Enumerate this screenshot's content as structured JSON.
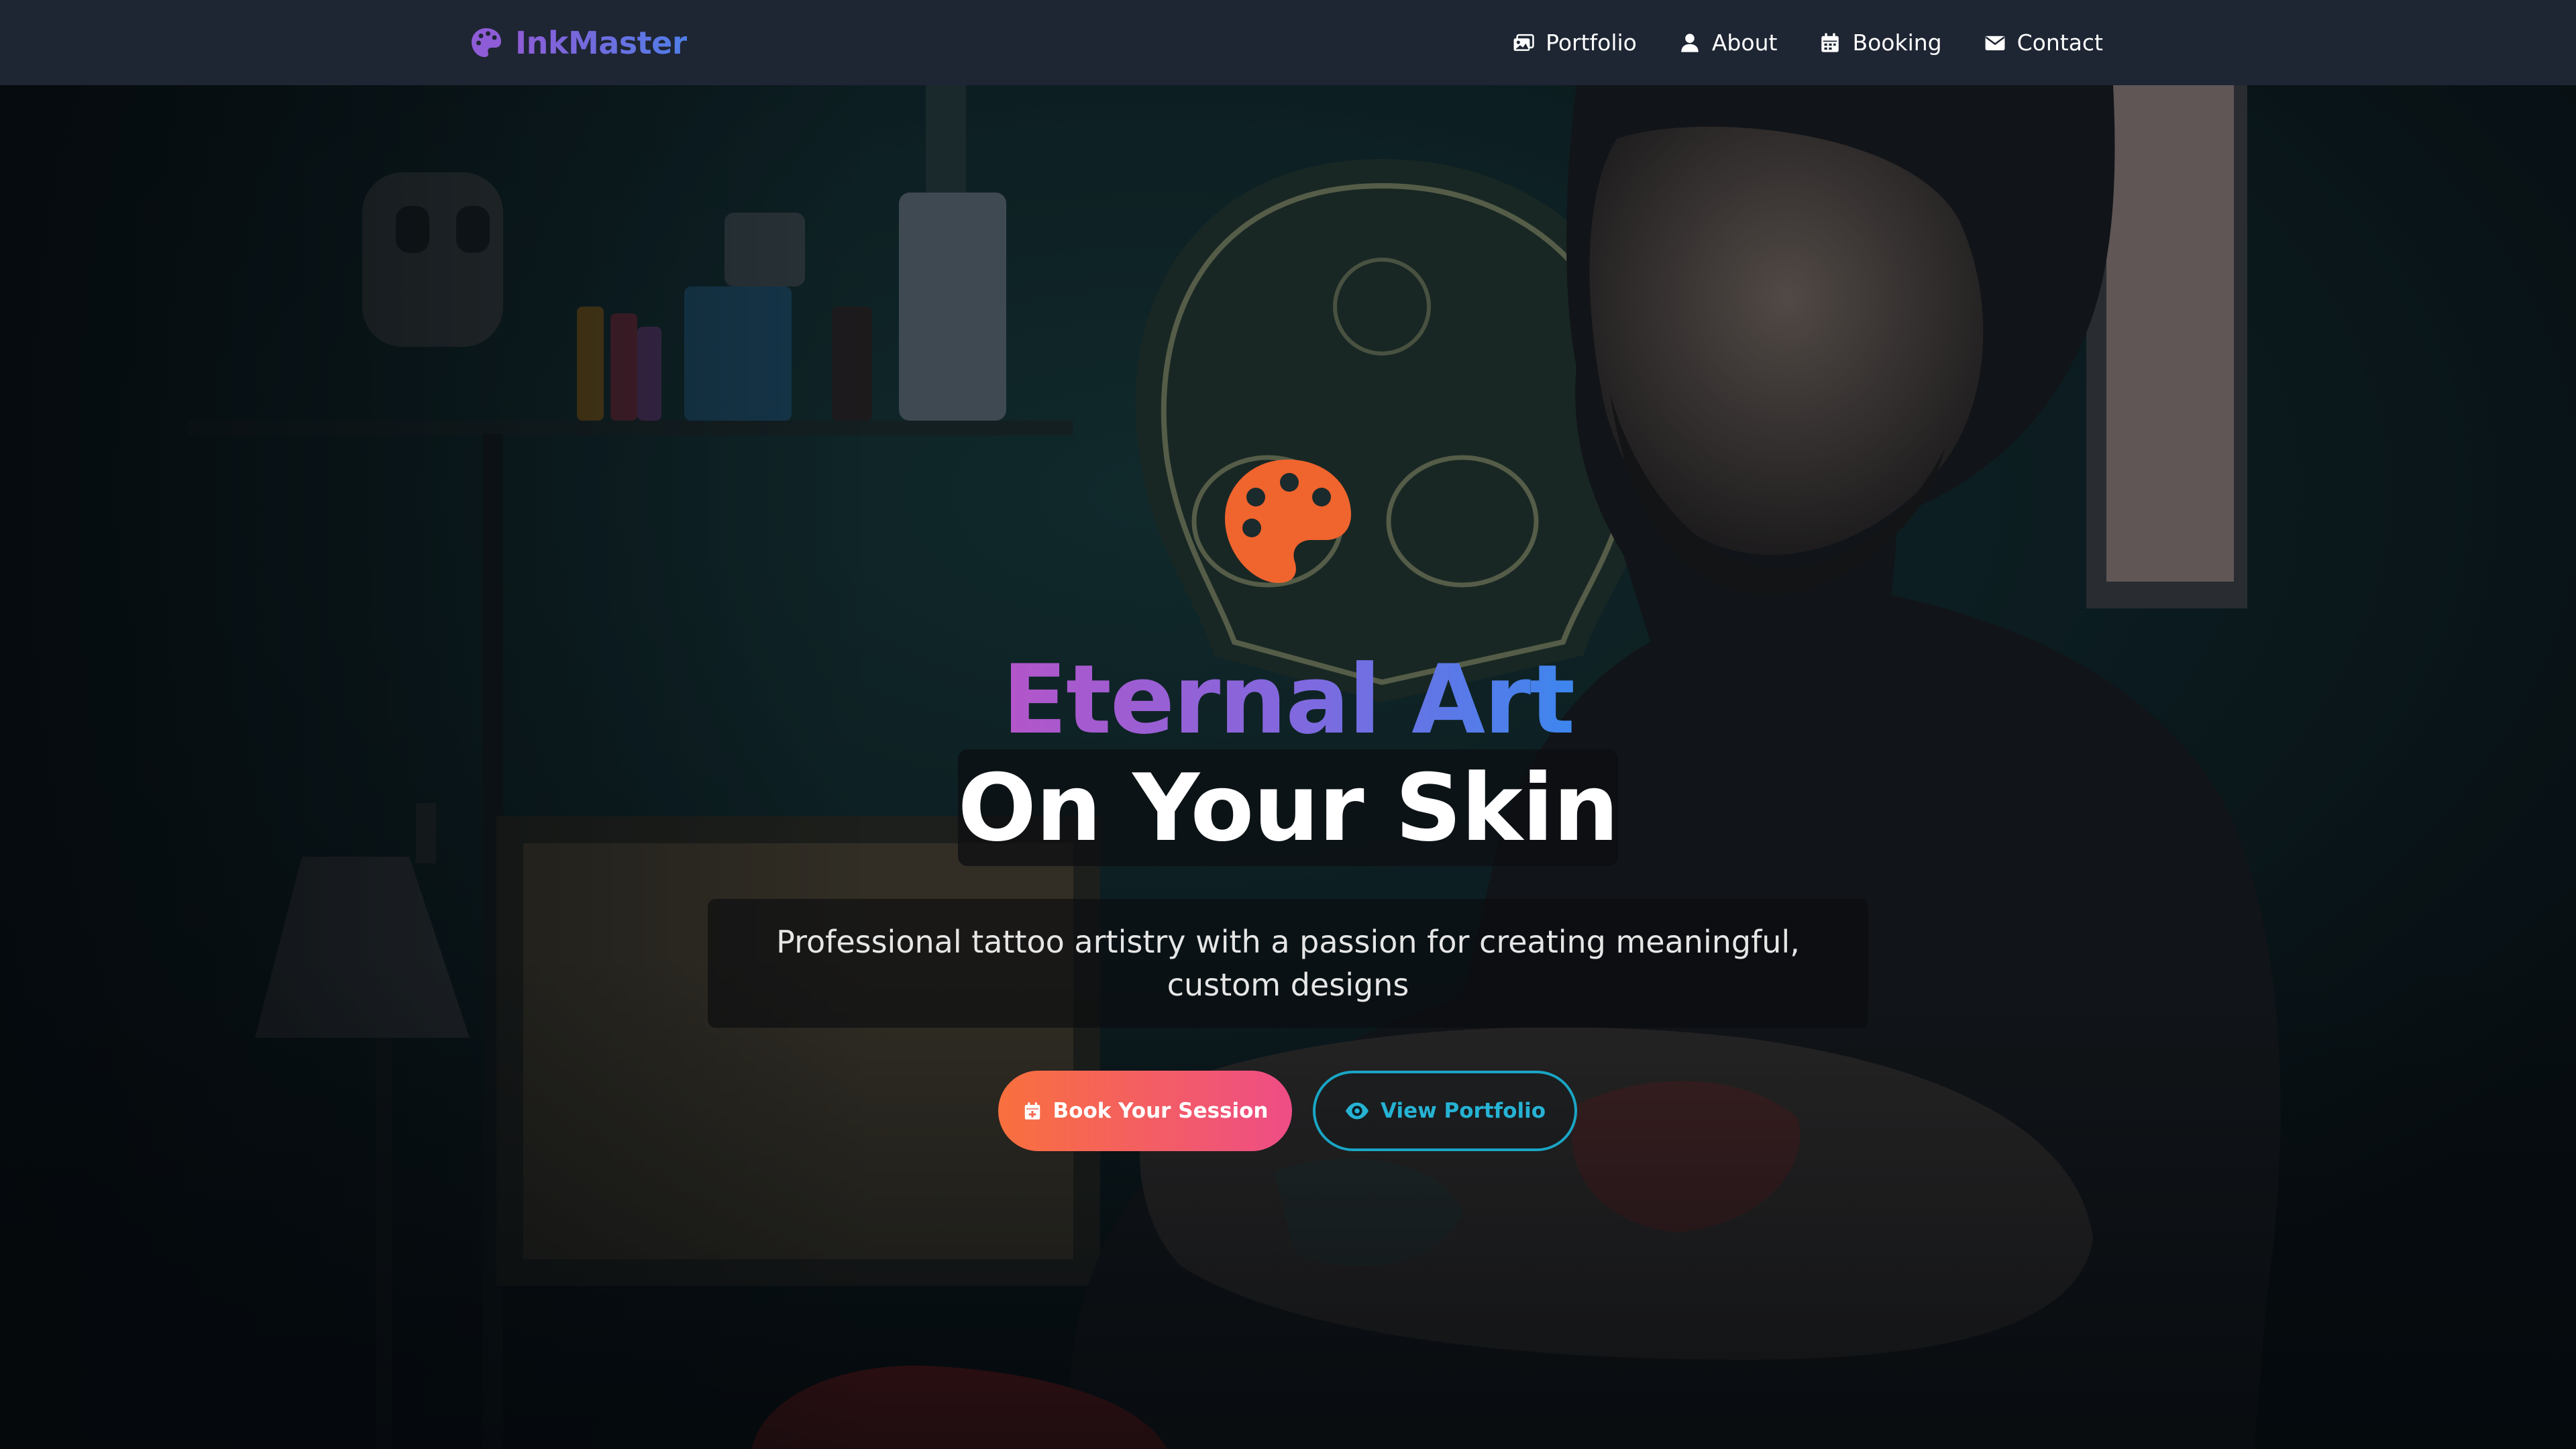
{
  "navbar": {
    "brand_name": "InkMaster",
    "brand_icon": "palette-icon",
    "links": [
      {
        "label": "Portfolio",
        "icon": "images-icon"
      },
      {
        "label": "About",
        "icon": "user-icon"
      },
      {
        "label": "Booking",
        "icon": "calendar-icon"
      },
      {
        "label": "Contact",
        "icon": "envelope-icon"
      }
    ]
  },
  "hero": {
    "emblem_icon": "palette-icon",
    "title_line_1": "Eternal Art",
    "title_line_2": "On Your Skin",
    "subtitle": "Professional tattoo artistry with a passion for creating meaningful, custom designs",
    "primary_button": {
      "label": "Book Your Session",
      "icon": "calendar-plus-icon"
    },
    "secondary_button": {
      "label": "View Portfolio",
      "icon": "eye-icon"
    }
  },
  "colors": {
    "navbar_bg": "#1e2533",
    "brand_gradient_start": "#8e5cd6",
    "brand_gradient_end": "#4f7ee8",
    "emblem": "#f0642e",
    "title_gradient_start": "#b455c9",
    "title_gradient_end": "#3d86ee",
    "primary_gradient_start": "#f9703e",
    "primary_gradient_end": "#ee4d86",
    "secondary_accent": "#1aa5c4"
  }
}
